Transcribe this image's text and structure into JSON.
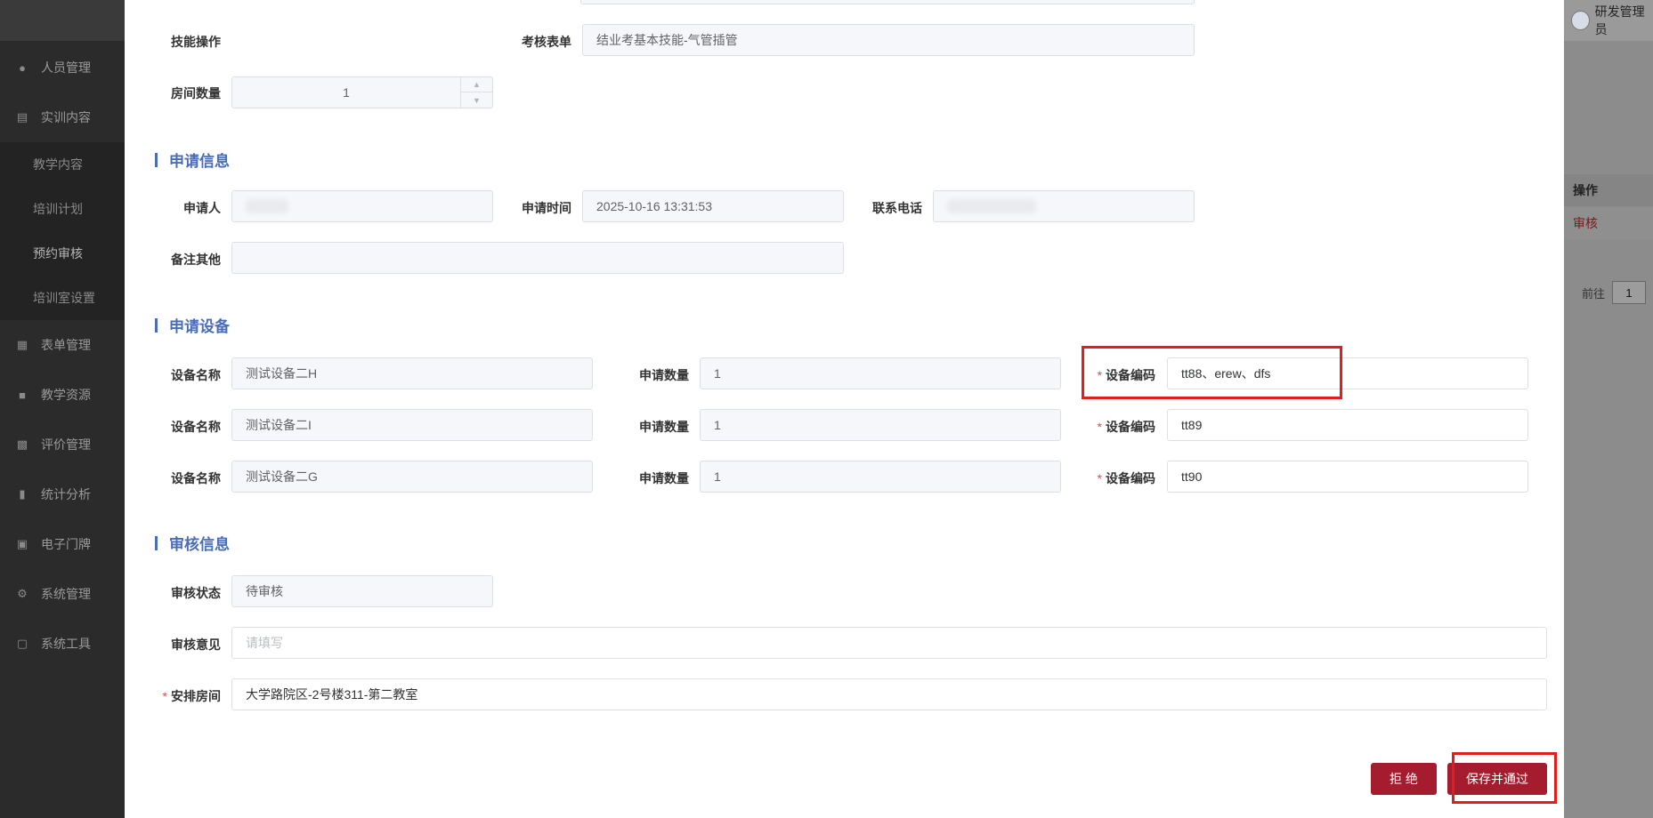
{
  "sidebar": {
    "items": [
      {
        "label": "人员管理",
        "icon": "user-icon"
      },
      {
        "label": "实训内容",
        "icon": "training-icon"
      },
      {
        "label": "表单管理",
        "icon": "form-icon"
      },
      {
        "label": "教学资源",
        "icon": "resource-icon"
      },
      {
        "label": "评价管理",
        "icon": "evaluation-icon"
      },
      {
        "label": "统计分析",
        "icon": "chart-icon"
      },
      {
        "label": "电子门牌",
        "icon": "monitor-icon"
      },
      {
        "label": "系统管理",
        "icon": "gear-icon"
      },
      {
        "label": "系统工具",
        "icon": "toolbox-icon"
      }
    ],
    "sub_items": [
      "教学内容",
      "培训计划",
      "预约审核",
      "培训室设置"
    ]
  },
  "background": {
    "username": "研发管理员",
    "table_header": "操作",
    "row_action": "审核",
    "pager_goto": "前往",
    "pager_page": "1"
  },
  "form": {
    "skill_label": "技能操作",
    "exam_form_label": "考核表单",
    "exam_form_value": "结业考基本技能-气管插管",
    "room_count_label": "房间数量",
    "room_count_value": "1"
  },
  "apply_info": {
    "title": "申请信息",
    "applicant_label": "申请人",
    "apply_time_label": "申请时间",
    "apply_time_value": "2025-10-16 13:31:53",
    "phone_label": "联系电话",
    "remark_label": "备注其他"
  },
  "apply_devices": {
    "title": "申请设备",
    "name_label": "设备名称",
    "qty_label": "申请数量",
    "code_label": "设备编码",
    "rows": [
      {
        "name": "测试设备二H",
        "qty": "1",
        "code": "tt88、erew、dfs"
      },
      {
        "name": "测试设备二I",
        "qty": "1",
        "code": "tt89"
      },
      {
        "name": "测试设备二G",
        "qty": "1",
        "code": "tt90"
      }
    ]
  },
  "review_info": {
    "title": "审核信息",
    "status_label": "审核状态",
    "status_value": "待审核",
    "opinion_label": "审核意见",
    "opinion_placeholder": "请填写",
    "room_label": "安排房间",
    "room_value": "大学路院区-2号楼311-第二教室"
  },
  "actions": {
    "reject": "拒 绝",
    "save_pass": "保存并通过"
  },
  "colors": {
    "accent": "#a51c2e",
    "section_title": "#4a6db8",
    "highlight": "#e01e1e"
  }
}
